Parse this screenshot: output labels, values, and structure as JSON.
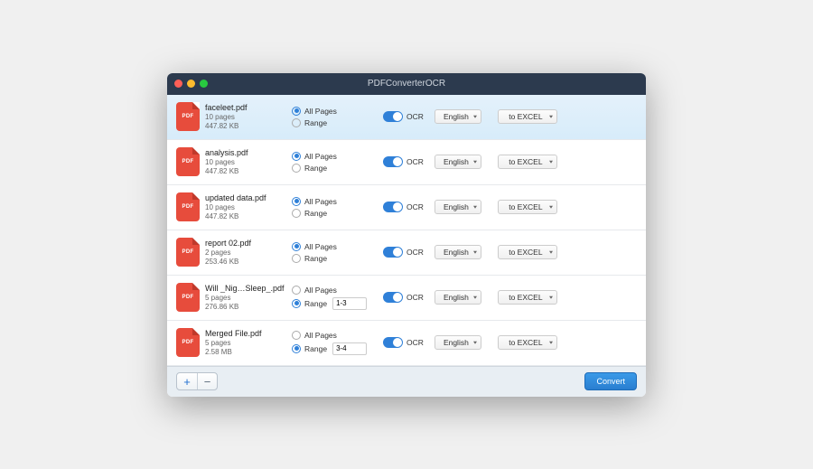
{
  "window": {
    "title": "PDFConverterOCR"
  },
  "labels": {
    "allpages": "All Pages",
    "range": "Range",
    "ocr": "OCR"
  },
  "files": [
    {
      "name": "faceleet.pdf",
      "pages": "10 pages",
      "size": "447.82 KB",
      "pagesel": "all",
      "rangeval": "",
      "ocr": true,
      "lang": "English",
      "format": "to EXCEL",
      "selected": true
    },
    {
      "name": "analysis.pdf",
      "pages": "10 pages",
      "size": "447.82 KB",
      "pagesel": "all",
      "rangeval": "",
      "ocr": true,
      "lang": "English",
      "format": "to EXCEL",
      "selected": false
    },
    {
      "name": "updated data.pdf",
      "pages": "10 pages",
      "size": "447.82 KB",
      "pagesel": "all",
      "rangeval": "",
      "ocr": true,
      "lang": "English",
      "format": "to EXCEL",
      "selected": false
    },
    {
      "name": "report 02.pdf",
      "pages": "2 pages",
      "size": "253.46 KB",
      "pagesel": "all",
      "rangeval": "",
      "ocr": true,
      "lang": "English",
      "format": "to EXCEL",
      "selected": false
    },
    {
      "name": "Will _Nig…Sleep_.pdf",
      "pages": "5 pages",
      "size": "276.86 KB",
      "pagesel": "range",
      "rangeval": "1-3",
      "ocr": true,
      "lang": "English",
      "format": "to EXCEL",
      "selected": false
    },
    {
      "name": "Merged File.pdf",
      "pages": "5 pages",
      "size": "2.58 MB",
      "pagesel": "range",
      "rangeval": "3-4",
      "ocr": true,
      "lang": "English",
      "format": "to EXCEL",
      "selected": false
    }
  ],
  "footer": {
    "add": "+",
    "remove": "−",
    "convert": "Convert"
  }
}
